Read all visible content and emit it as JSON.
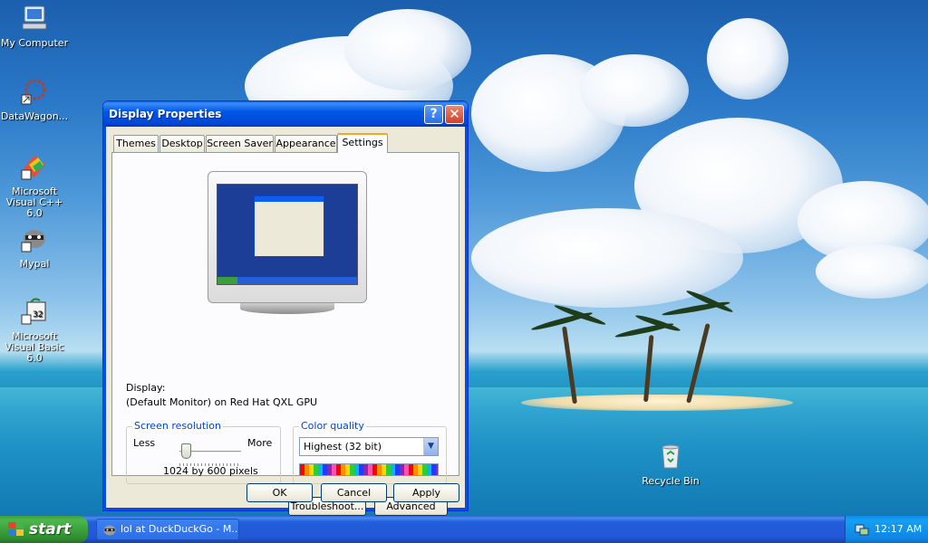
{
  "desktop": {
    "icons": [
      {
        "label": "My Computer"
      },
      {
        "label": "DataWagon..."
      },
      {
        "label": "Microsoft Visual C++ 6.0"
      },
      {
        "label": "Mypal"
      },
      {
        "label": "Microsoft Visual Basic 6.0"
      },
      {
        "label": "Recycle Bin"
      }
    ]
  },
  "window": {
    "title": "Display Properties",
    "tabs": [
      "Themes",
      "Desktop",
      "Screen Saver",
      "Appearance",
      "Settings"
    ],
    "active_tab": "Settings",
    "display_label": "Display:",
    "display_value": "(Default Monitor) on Red Hat QXL GPU",
    "resolution": {
      "title": "Screen resolution",
      "less": "Less",
      "more": "More",
      "value_text": "1024 by 600 pixels",
      "slider_position": 0.1
    },
    "color_quality": {
      "title": "Color quality",
      "selected": "Highest (32 bit)"
    },
    "buttons": {
      "troubleshoot": "Troubleshoot...",
      "advanced": "Advanced",
      "ok": "OK",
      "cancel": "Cancel",
      "apply": "Apply"
    }
  },
  "taskbar": {
    "start_label": "start",
    "task_item": "lol at DuckDuckGo - M...",
    "clock": "12:17 AM"
  },
  "colors": {
    "title_blue": "#0054e3",
    "taskbar_blue": "#245edb",
    "start_green": "#3c9d3c",
    "group_title": "#0046d5"
  }
}
